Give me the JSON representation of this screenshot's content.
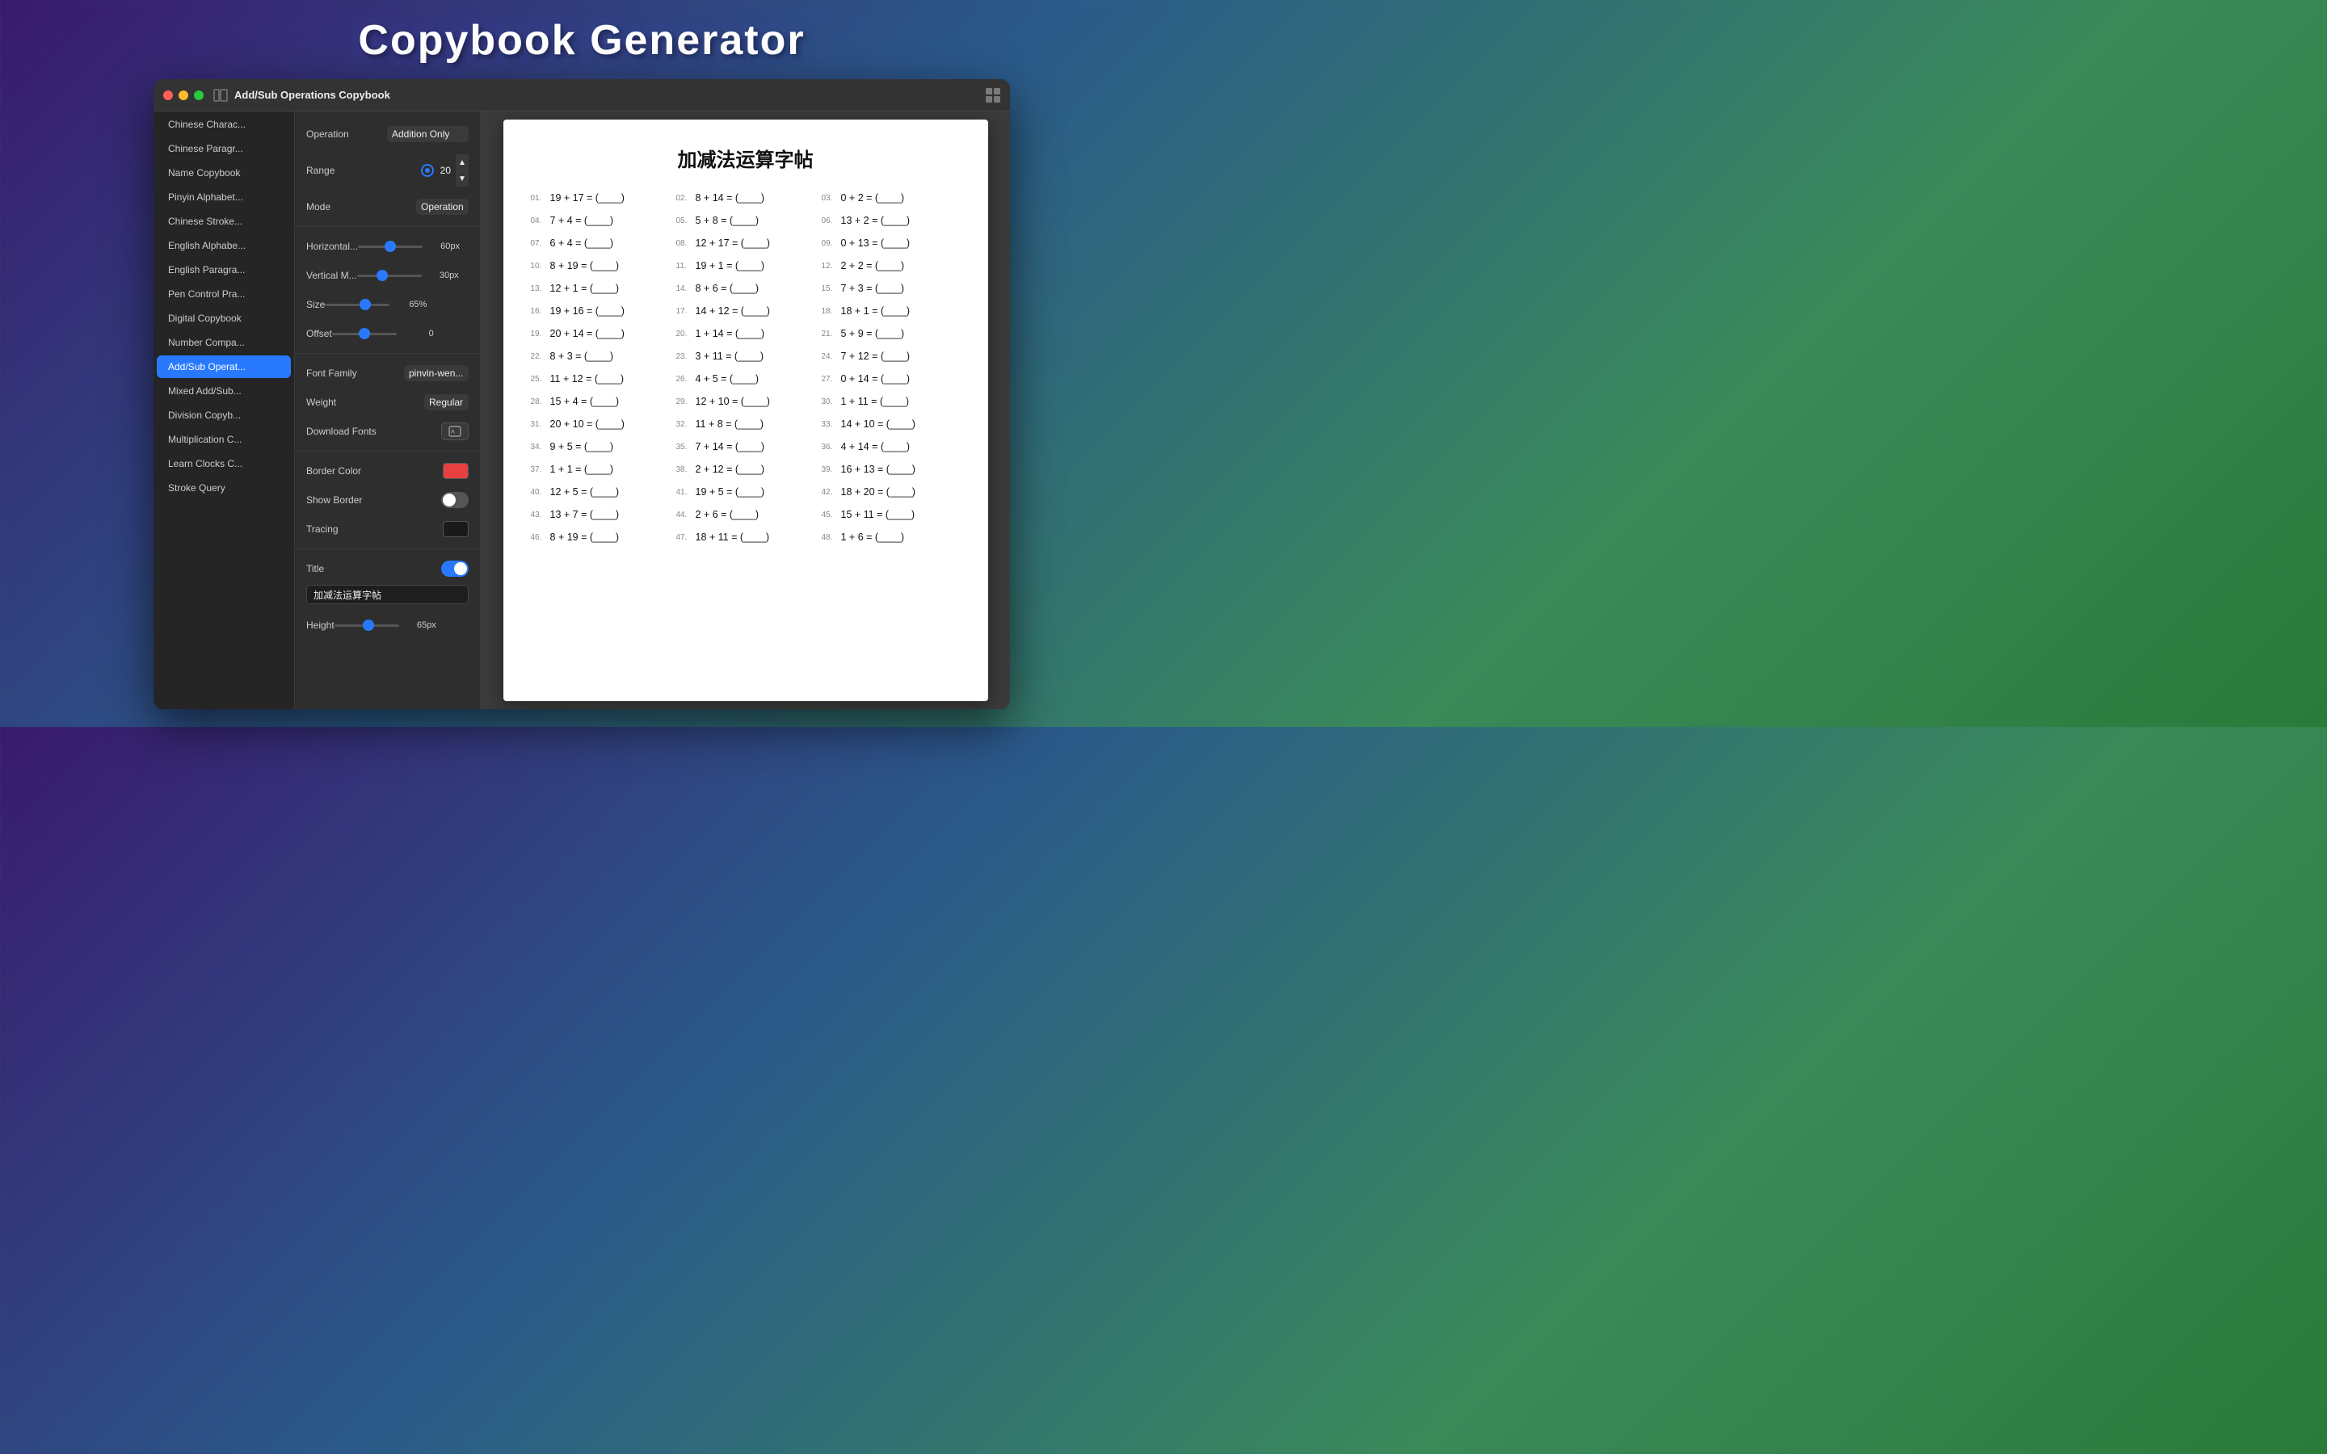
{
  "app": {
    "title": "Copybook Generator"
  },
  "window": {
    "title": "Add/Sub Operations Copybook"
  },
  "sidebar": {
    "items": [
      {
        "id": "chinese-char",
        "label": "Chinese Charac..."
      },
      {
        "id": "chinese-para",
        "label": "Chinese Paragr..."
      },
      {
        "id": "name-copybook",
        "label": "Name Copybook"
      },
      {
        "id": "pinyin-alpha",
        "label": "Pinyin Alphabet..."
      },
      {
        "id": "chinese-stroke",
        "label": "Chinese Stroke..."
      },
      {
        "id": "english-alpha",
        "label": "English Alphabe..."
      },
      {
        "id": "english-para",
        "label": "English Paragra..."
      },
      {
        "id": "pen-control",
        "label": "Pen Control Pra..."
      },
      {
        "id": "digital-copybook",
        "label": "Digital Copybook"
      },
      {
        "id": "number-comp",
        "label": "Number Compa..."
      },
      {
        "id": "add-sub",
        "label": "Add/Sub Operat...",
        "active": true
      },
      {
        "id": "mixed-add-sub",
        "label": "Mixed Add/Sub..."
      },
      {
        "id": "division-copy",
        "label": "Division Copyb..."
      },
      {
        "id": "multiplication",
        "label": "Multiplication C..."
      },
      {
        "id": "learn-clocks",
        "label": "Learn Clocks C..."
      },
      {
        "id": "stroke-query",
        "label": "Stroke Query"
      }
    ]
  },
  "settings": {
    "operation_label": "Operation",
    "operation_value": "Addition Only",
    "range_label": "Range",
    "range_value": "20",
    "mode_label": "Mode",
    "mode_value": "Operation",
    "horizontal_label": "Horizontal...",
    "horizontal_value": "60px",
    "horizontal_slider": 60,
    "vertical_label": "Vertical M...",
    "vertical_value": "30px",
    "vertical_slider": 30,
    "size_label": "Size",
    "size_value": "65%",
    "size_slider": 65,
    "offset_label": "Offset",
    "offset_value": "0",
    "offset_slider": 0,
    "font_family_label": "Font Family",
    "font_family_value": "pinvin-wen...",
    "weight_label": "Weight",
    "weight_value": "Regular",
    "download_fonts_label": "Download Fonts",
    "border_color_label": "Border Color",
    "show_border_label": "Show Border",
    "tracing_label": "Tracing",
    "title_label": "Title",
    "title_input": "加减法运算字帖",
    "height_label": "Height",
    "height_value": "65px",
    "height_slider": 65
  },
  "preview": {
    "title": "加减法运算字帖",
    "equations": [
      {
        "num": "01.",
        "expr": "19 + 17 = (____)"
      },
      {
        "num": "02.",
        "expr": "8 + 14 = (____)"
      },
      {
        "num": "03.",
        "expr": "0 + 2 = (____)"
      },
      {
        "num": "04.",
        "expr": "7 + 4 = (____)"
      },
      {
        "num": "05.",
        "expr": "5 + 8 = (____)"
      },
      {
        "num": "06.",
        "expr": "13 + 2 = (____)"
      },
      {
        "num": "07.",
        "expr": "6 + 4 = (____)"
      },
      {
        "num": "08.",
        "expr": "12 + 17 = (____)"
      },
      {
        "num": "09.",
        "expr": "0 + 13 = (____)"
      },
      {
        "num": "10.",
        "expr": "8 + 19 = (____)"
      },
      {
        "num": "11.",
        "expr": "19 + 1 = (____)"
      },
      {
        "num": "12.",
        "expr": "2 + 2 = (____)"
      },
      {
        "num": "13.",
        "expr": "12 + 1 = (____)"
      },
      {
        "num": "14.",
        "expr": "8 + 6 = (____)"
      },
      {
        "num": "15.",
        "expr": "7 + 3 = (____)"
      },
      {
        "num": "16.",
        "expr": "19 + 16 = (____)"
      },
      {
        "num": "17.",
        "expr": "14 + 12 = (____)"
      },
      {
        "num": "18.",
        "expr": "18 + 1 = (____)"
      },
      {
        "num": "19.",
        "expr": "20 + 14 = (____)"
      },
      {
        "num": "20.",
        "expr": "1 + 14 = (____)"
      },
      {
        "num": "21.",
        "expr": "5 + 9 = (____)"
      },
      {
        "num": "22.",
        "expr": "8 + 3 = (____)"
      },
      {
        "num": "23.",
        "expr": "3 + 11 = (____)"
      },
      {
        "num": "24.",
        "expr": "7 + 12 = (____)"
      },
      {
        "num": "25.",
        "expr": "11 + 12 = (____)"
      },
      {
        "num": "26.",
        "expr": "4 + 5 = (____)"
      },
      {
        "num": "27.",
        "expr": "0 + 14 = (____)"
      },
      {
        "num": "28.",
        "expr": "15 + 4 = (____)"
      },
      {
        "num": "29.",
        "expr": "12 + 10 = (____)"
      },
      {
        "num": "30.",
        "expr": "1 + 11 = (____)"
      },
      {
        "num": "31.",
        "expr": "20 + 10 = (____)"
      },
      {
        "num": "32.",
        "expr": "11 + 8 = (____)"
      },
      {
        "num": "33.",
        "expr": "14 + 10 = (____)"
      },
      {
        "num": "34.",
        "expr": "9 + 5 = (____)"
      },
      {
        "num": "35.",
        "expr": "7 + 14 = (____)"
      },
      {
        "num": "36.",
        "expr": "4 + 14 = (____)"
      },
      {
        "num": "37.",
        "expr": "1 + 1 = (____)"
      },
      {
        "num": "38.",
        "expr": "2 + 12 = (____)"
      },
      {
        "num": "39.",
        "expr": "16 + 13 = (____)"
      },
      {
        "num": "40.",
        "expr": "12 + 5 = (____)"
      },
      {
        "num": "41.",
        "expr": "19 + 5 = (____)"
      },
      {
        "num": "42.",
        "expr": "18 + 20 = (____)"
      },
      {
        "num": "43.",
        "expr": "13 + 7 = (____)"
      },
      {
        "num": "44.",
        "expr": "2 + 6 = (____)"
      },
      {
        "num": "45.",
        "expr": "15 + 11 = (____)"
      },
      {
        "num": "46.",
        "expr": "8 + 19 = (____)"
      },
      {
        "num": "47.",
        "expr": "18 + 11 = (____)"
      },
      {
        "num": "48.",
        "expr": "1 + 6 = (____)"
      }
    ]
  }
}
